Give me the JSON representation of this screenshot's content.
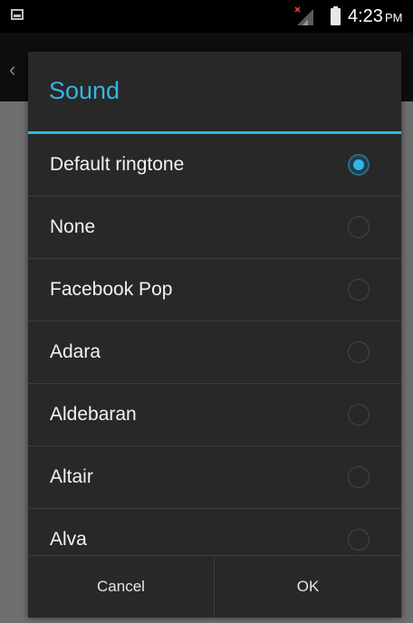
{
  "status_bar": {
    "time": "4:23",
    "ampm": "PM",
    "icons": [
      "notification-icon",
      "signal-no-sim-icon",
      "battery-icon"
    ]
  },
  "dialog": {
    "title": "Sound",
    "items": [
      {
        "label": "Default ringtone",
        "selected": true
      },
      {
        "label": "None",
        "selected": false
      },
      {
        "label": "Facebook Pop",
        "selected": false
      },
      {
        "label": "Adara",
        "selected": false
      },
      {
        "label": "Aldebaran",
        "selected": false
      },
      {
        "label": "Altair",
        "selected": false
      },
      {
        "label": "Alva",
        "selected": false
      }
    ],
    "cancel_label": "Cancel",
    "ok_label": "OK"
  },
  "colors": {
    "accent": "#33b5e5",
    "dialog_bg": "#282828"
  }
}
